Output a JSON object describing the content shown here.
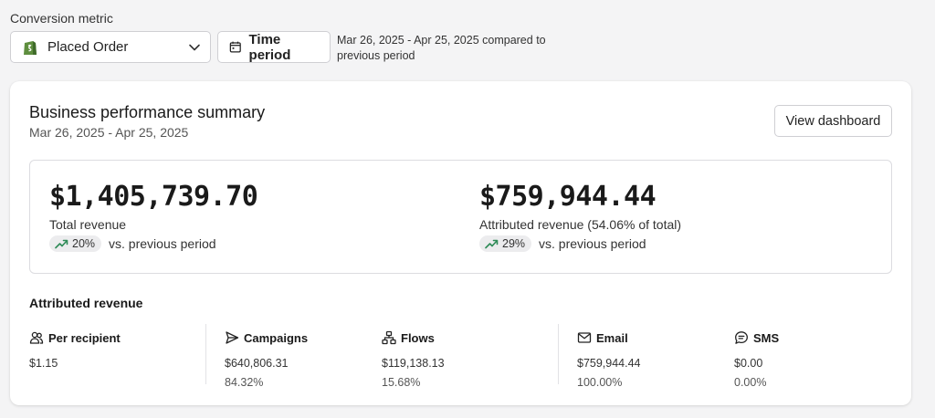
{
  "filters": {
    "metric_label": "Conversion metric",
    "metric_value": "Placed Order",
    "time_button": "Time period",
    "range_note": "Mar 26, 2025 - Apr 25, 2025 compared to previous period"
  },
  "summary": {
    "title": "Business performance summary",
    "date_range": "Mar 26, 2025 - Apr 25, 2025",
    "view_button": "View dashboard",
    "total": {
      "amount": "$1,405,739.70",
      "label": "Total revenue",
      "change": "20%",
      "comparison": "vs. previous period"
    },
    "attributed": {
      "amount": "$759,944.44",
      "label": "Attributed revenue (54.06% of total)",
      "change": "29%",
      "comparison": "vs. previous period"
    }
  },
  "attributed_revenue": {
    "title": "Attributed revenue",
    "stats": [
      {
        "icon": "users-icon",
        "label": "Per recipient",
        "value": "$1.15",
        "percent": ""
      },
      {
        "icon": "send-icon",
        "label": "Campaigns",
        "value": "$640,806.31",
        "percent": "84.32%"
      },
      {
        "icon": "flows-icon",
        "label": "Flows",
        "value": "$119,138.13",
        "percent": "15.68%"
      },
      {
        "icon": "mail-icon",
        "label": "Email",
        "value": "$759,944.44",
        "percent": "100.00%"
      },
      {
        "icon": "sms-icon",
        "label": "SMS",
        "value": "$0.00",
        "percent": "0.00%"
      }
    ]
  },
  "colors": {
    "trend_up": "#2e8b57",
    "pill_bg": "#ececee",
    "shopify_green": "#5e8e3e"
  }
}
